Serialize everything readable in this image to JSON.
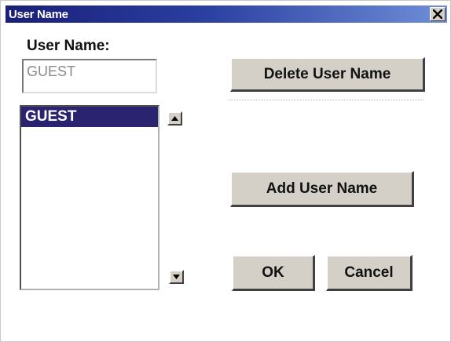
{
  "window": {
    "title": "User Name",
    "close_glyph": "✕"
  },
  "form": {
    "label": "User Name:",
    "input_value": "GUEST"
  },
  "list": {
    "items": [
      "GUEST"
    ],
    "selected_index": 0
  },
  "buttons": {
    "delete": "Delete User Name",
    "add": "Add User Name",
    "ok": "OK",
    "cancel": "Cancel"
  },
  "colors": {
    "title_bar": "#1a1f78",
    "selection": "#2a2470",
    "button_face": "#d4d0c8"
  }
}
